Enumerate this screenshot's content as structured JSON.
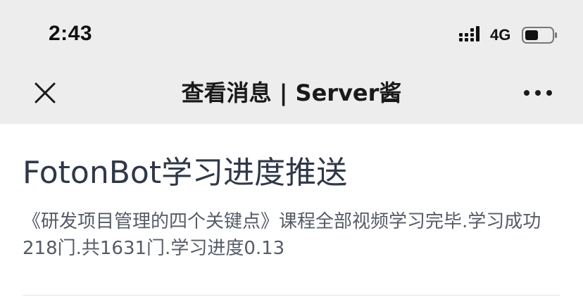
{
  "status_bar": {
    "time": "2:43",
    "network": "4G",
    "icons": [
      "signal-icon",
      "battery-icon"
    ]
  },
  "nav": {
    "title": "查看消息 | Server酱",
    "close_icon": "close-icon",
    "more_icon": "more-icon"
  },
  "message": {
    "title": "FotonBot学习进度推送",
    "body": "《研发项目管理的四个关键点》课程全部视频学习完毕.学习成功218门.共1631门.学习进度0.13"
  },
  "colors": {
    "header_bg": "#ededed",
    "title_text": "#2f3848",
    "body_text": "#555b66"
  }
}
